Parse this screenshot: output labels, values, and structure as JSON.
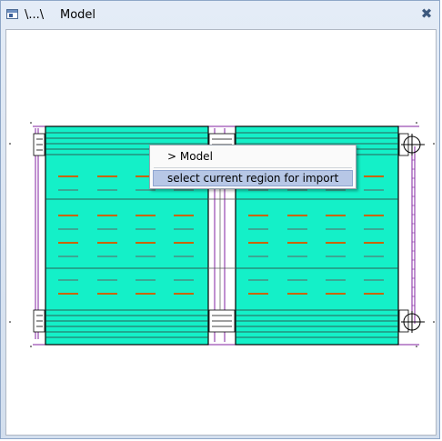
{
  "window": {
    "path": "\\...\\",
    "title": "Model",
    "close_icon": "close-icon"
  },
  "context_menu": {
    "item_model": "> Model",
    "item_select": "select current region for import"
  },
  "colors": {
    "slab_fill": "#14f0c8",
    "reinforcement": "#c86400",
    "wall_lines": "#8020a0"
  }
}
